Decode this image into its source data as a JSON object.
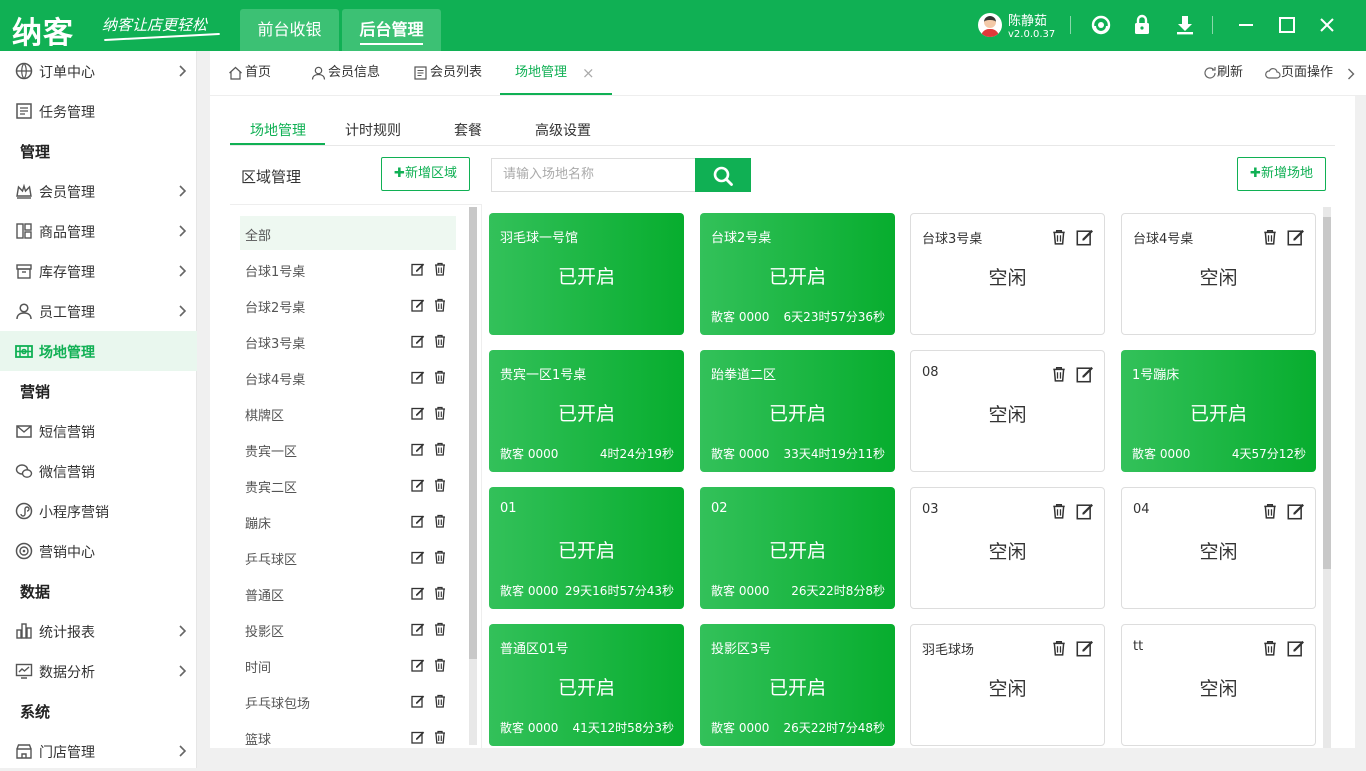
{
  "app": {
    "logo": "纳客",
    "slogan": "纳客让店更轻松"
  },
  "top_tabs": [
    "前台收银",
    "后台管理"
  ],
  "user": {
    "name": "陈静茹",
    "version": "v2.0.0.37"
  },
  "sidebar": {
    "items": [
      {
        "label": "订单中心",
        "icon": "order-icon",
        "arrow": true
      },
      {
        "label": "任务管理",
        "icon": "task-icon",
        "arrow": false
      },
      {
        "section": "管理"
      },
      {
        "label": "会员管理",
        "icon": "crown-icon",
        "arrow": true
      },
      {
        "label": "商品管理",
        "icon": "goods-icon",
        "arrow": true
      },
      {
        "label": "库存管理",
        "icon": "inventory-icon",
        "arrow": true
      },
      {
        "label": "员工管理",
        "icon": "person-icon",
        "arrow": true
      },
      {
        "label": "场地管理",
        "icon": "venue-icon",
        "arrow": false,
        "active": true
      },
      {
        "section": "营销"
      },
      {
        "label": "短信营销",
        "icon": "mail-icon",
        "arrow": false
      },
      {
        "label": "微信营销",
        "icon": "wechat-icon",
        "arrow": false
      },
      {
        "label": "小程序营销",
        "icon": "miniprogram-icon",
        "arrow": false
      },
      {
        "label": "营销中心",
        "icon": "target-icon",
        "arrow": false
      },
      {
        "section": "数据"
      },
      {
        "label": "统计报表",
        "icon": "bar-chart-icon",
        "arrow": true
      },
      {
        "label": "数据分析",
        "icon": "analysis-icon",
        "arrow": true
      },
      {
        "section": "系统"
      },
      {
        "label": "门店管理",
        "icon": "store-icon",
        "arrow": true
      }
    ]
  },
  "page_tabs": [
    {
      "label": "首页",
      "icon": "home-icon"
    },
    {
      "label": "会员信息",
      "icon": "user-icon"
    },
    {
      "label": "会员列表",
      "icon": "list-icon"
    },
    {
      "label": "场地管理",
      "icon": "",
      "active": true,
      "close": "×"
    }
  ],
  "page_actions": {
    "refresh": "刷新",
    "operate": "页面操作"
  },
  "sub_tabs": [
    "场地管理",
    "计时规则",
    "套餐",
    "高级设置"
  ],
  "area": {
    "title": "区域管理",
    "add_button": "新增区域",
    "items": [
      "全部",
      "台球1号桌",
      "台球2号桌",
      "台球3号桌",
      "台球4号桌",
      "棋牌区",
      "贵宾一区",
      "贵宾二区",
      "蹦床",
      "乒乓球区",
      "普通区",
      "投影区",
      "时间",
      "乒乓球包场",
      "篮球"
    ]
  },
  "venue": {
    "search_placeholder": "请输入场地名称",
    "add_button": "新增场地",
    "cards": [
      {
        "name": "羽毛球一号馆",
        "status": "已开启",
        "on": true,
        "guest": "",
        "time": ""
      },
      {
        "name": "台球2号桌",
        "status": "已开启",
        "on": true,
        "guest": "散客 0000",
        "time": "6天23时57分36秒"
      },
      {
        "name": "台球3号桌",
        "status": "空闲",
        "on": false
      },
      {
        "name": "台球4号桌",
        "status": "空闲",
        "on": false
      },
      {
        "name": "贵宾一区1号桌",
        "status": "已开启",
        "on": true,
        "guest": "散客 0000",
        "time": "4时24分19秒"
      },
      {
        "name": "跆拳道二区",
        "status": "已开启",
        "on": true,
        "guest": "散客 0000",
        "time": "33天4时19分11秒"
      },
      {
        "name": "08",
        "status": "空闲",
        "on": false
      },
      {
        "name": "1号蹦床",
        "status": "已开启",
        "on": true,
        "guest": "散客 0000",
        "time": "4天57分12秒"
      },
      {
        "name": "01",
        "status": "已开启",
        "on": true,
        "guest": "散客 0000",
        "time": "29天16时57分43秒"
      },
      {
        "name": "02",
        "status": "已开启",
        "on": true,
        "guest": "散客 0000",
        "time": "26天22时8分8秒"
      },
      {
        "name": "03",
        "status": "空闲",
        "on": false
      },
      {
        "name": "04",
        "status": "空闲",
        "on": false
      },
      {
        "name": "普通区01号",
        "status": "已开启",
        "on": true,
        "guest": "散客 0000",
        "time": "41天12时58分3秒"
      },
      {
        "name": "投影区3号",
        "status": "已开启",
        "on": true,
        "guest": "散客 0000",
        "time": "26天22时7分48秒"
      },
      {
        "name": "羽毛球场",
        "status": "空闲",
        "on": false
      },
      {
        "name": "tt",
        "status": "空闲",
        "on": false
      }
    ]
  },
  "colors": {
    "brand": "#10b054",
    "active_card": "#1db545"
  }
}
